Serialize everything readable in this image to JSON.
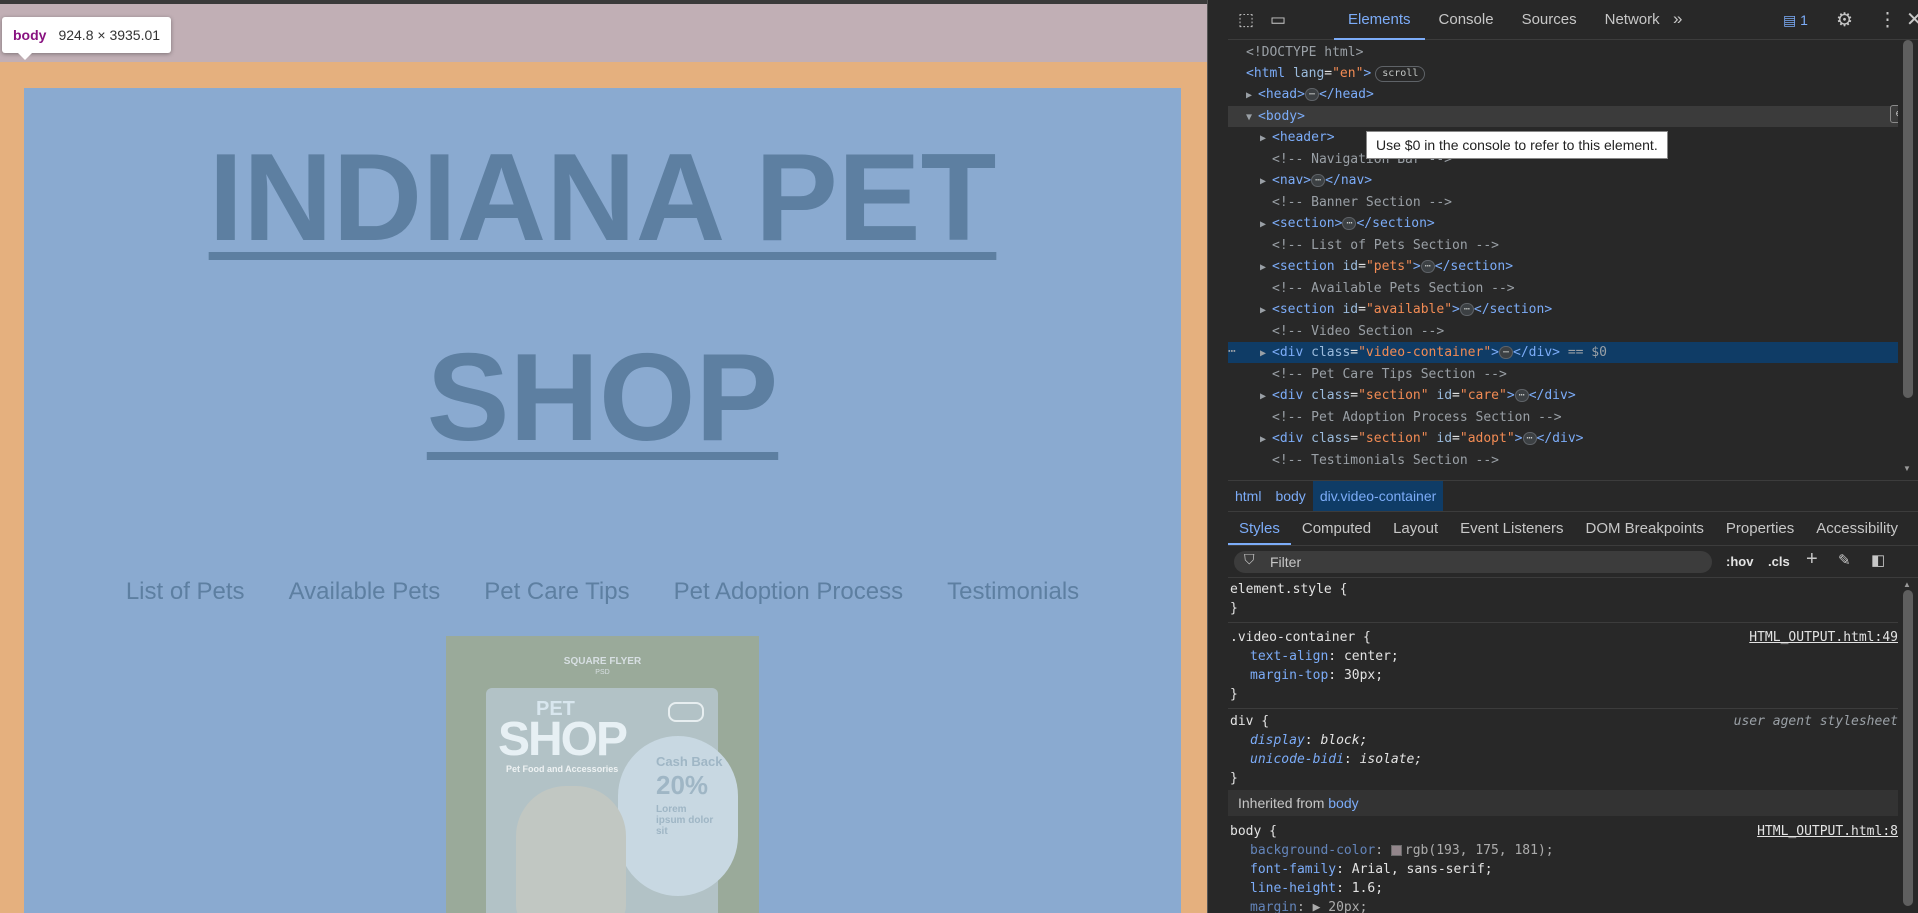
{
  "preview": {
    "tooltip_tag": "body",
    "tooltip_dims": "924.8 × 3935.01",
    "title_line1": "INDIANA PET",
    "title_line2": "SHOP",
    "nav": [
      "List of Pets",
      "Available Pets",
      "Pet Care Tips",
      "Pet Adoption Process",
      "Testimonials"
    ],
    "flyer": {
      "square_flyer": "SQUARE FLYER",
      "square_sub": "PSD",
      "pet": "PET",
      "shop": "SHOP",
      "food": "Pet Food and Accessories",
      "cash_back": "Cash Back",
      "percent": "20%",
      "lorem": "Lorem ipsum dolor sit"
    }
  },
  "devtools": {
    "tabs": [
      "Elements",
      "Console",
      "Sources",
      "Network"
    ],
    "active_tab": "Elements",
    "more_tabs": "»",
    "message_count": "1",
    "tooltip": "Use $0 in the console to refer to this element.",
    "breadcrumb": [
      "html",
      "body",
      "div.video-container"
    ],
    "style_tabs": [
      "Styles",
      "Computed",
      "Layout",
      "Event Listeners",
      "DOM Breakpoints",
      "Properties",
      "Accessibility"
    ],
    "filter_placeholder": "Filter",
    "hov": ":hov",
    "cls": ".cls",
    "dom": {
      "doctype": "<!DOCTYPE html>",
      "html_open": "<html",
      "html_attr": "lang",
      "html_val": "\"en\"",
      "scroll_badge": "scroll",
      "head": "<head>",
      "head_close": "</head>",
      "body": "<body>",
      "header": "<header>",
      "c_nav": "<!-- Navigation Bar -->",
      "nav": "<nav>",
      "nav_close": "</nav>",
      "c_banner": "<!-- Banner Section -->",
      "section": "<section>",
      "section_close": "</section>",
      "c_list": "<!-- List of Pets Section -->",
      "section_pets_open": "<section",
      "id_attr": "id",
      "pets_val": "\"pets\"",
      "c_available": "<!-- Available Pets Section -->",
      "available_val": "\"available\"",
      "c_video": "<!-- Video Section -->",
      "div_open": "<div",
      "class_attr": "class",
      "video_val": "\"video-container\"",
      "div_close": "</div>",
      "eq_sel": "== $0",
      "c_care": "<!-- Pet Care Tips Section -->",
      "section_val": "\"section\"",
      "care_val": "\"care\"",
      "c_adopt": "<!-- Pet Adoption Process Section -->",
      "adopt_val": "\"adopt\"",
      "c_testimonials": "<!-- Testimonials Section -->"
    },
    "styles": {
      "element_style": "element.style {",
      "close_brace": "}",
      "video_selector": ".video-container {",
      "video_src": "HTML_OUTPUT.html:49",
      "text_align_prop": "text-align",
      "text_align_val": "center;",
      "margin_top_prop": "margin-top",
      "margin_top_val": "30px;",
      "div_selector": "div {",
      "ua": "user agent stylesheet",
      "display_prop": "display",
      "display_val": "block;",
      "unicode_prop": "unicode-bidi",
      "unicode_val": "isolate;",
      "inherited_label": "Inherited from",
      "inherited_el": "body",
      "body_selector": "body {",
      "body_src": "HTML_OUTPUT.html:8",
      "bg_prop": "background-color",
      "bg_val": "rgb(193, 175, 181);",
      "font_prop": "font-family",
      "font_val": "Arial, sans-serif;",
      "lh_prop": "line-height",
      "lh_val": "1.6;",
      "margin_prop": "margin",
      "margin_val": "20px;"
    }
  },
  "colors": {
    "content": "#8aaad0",
    "margin": "#e5b07e",
    "body_bg": "#c1afb5",
    "accent": "#7cacf8"
  }
}
